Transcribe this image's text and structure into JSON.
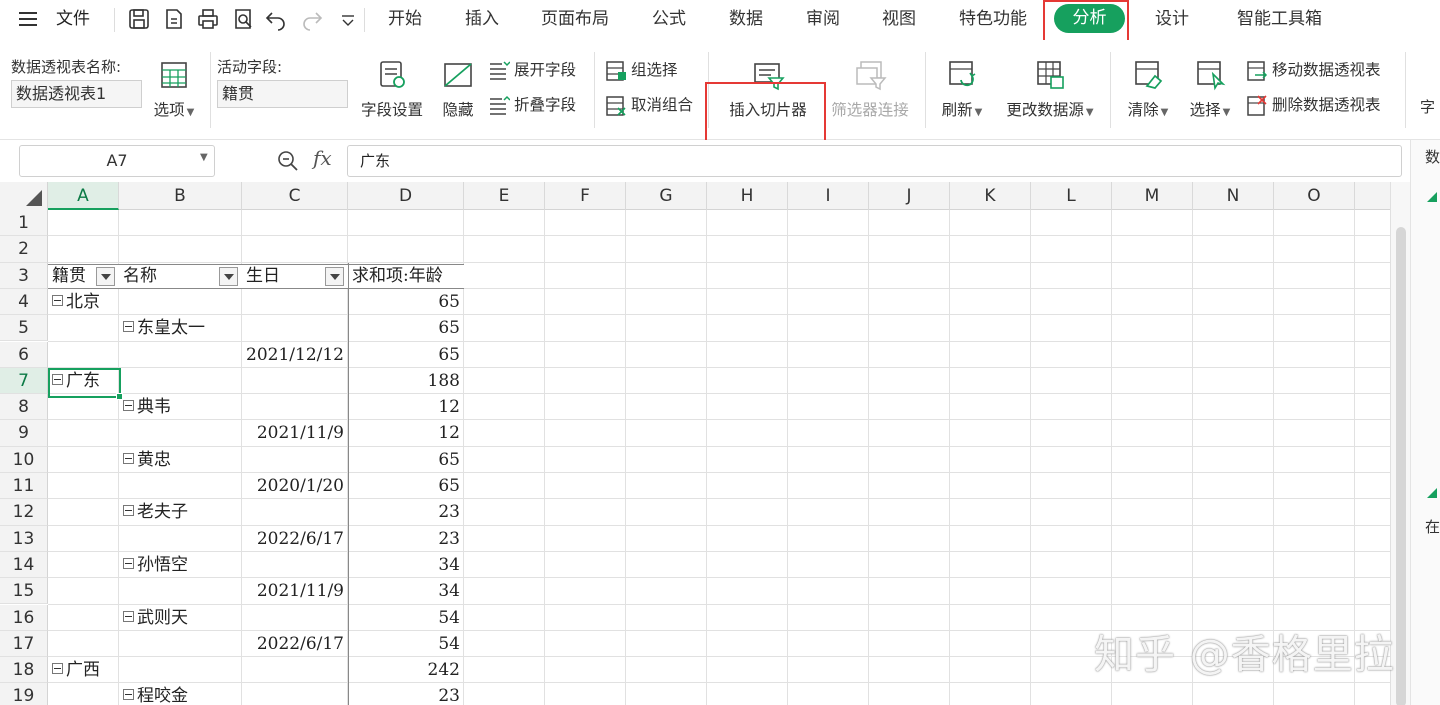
{
  "menubar": {
    "file_label": "文件",
    "tabs": [
      "开始",
      "插入",
      "页面布局",
      "公式",
      "数据",
      "审阅",
      "视图",
      "特色功能",
      "分析",
      "设计",
      "智能工具箱"
    ],
    "active_tab": "分析"
  },
  "ribbon": {
    "pivot_name_label": "数据透视表名称:",
    "pivot_name_value": "数据透视表1",
    "options_label": "选项",
    "active_field_label": "活动字段:",
    "active_field_value": "籍贯",
    "field_settings": "字段设置",
    "hide": "隐藏",
    "expand_field": "展开字段",
    "collapse_field": "折叠字段",
    "group_selection": "组选择",
    "ungroup": "取消组合",
    "insert_slicer": "插入切片器",
    "filter_connection": "筛选器连接",
    "refresh": "刷新",
    "change_source": "更改数据源",
    "clear": "清除",
    "select": "选择",
    "move_pivot": "移动数据透视表",
    "delete_pivot": "删除数据透视表",
    "cut_label": "字",
    "side_label_top": "数",
    "side_label_mid": "在"
  },
  "formula_bar": {
    "name_box": "A7",
    "fx": "fx",
    "formula": "广东"
  },
  "grid": {
    "columns": [
      "A",
      "B",
      "C",
      "D",
      "E",
      "F",
      "G",
      "H",
      "I",
      "J",
      "K",
      "L",
      "M",
      "N",
      "O"
    ],
    "rows": [
      "1",
      "2",
      "3",
      "4",
      "5",
      "6",
      "7",
      "8",
      "9",
      "10",
      "11",
      "12",
      "13",
      "14",
      "15",
      "16",
      "17",
      "18",
      "19"
    ],
    "selected_cell": "A7",
    "pivot_headers": [
      "籍贯",
      "名称",
      "生日",
      "求和项:年龄"
    ],
    "pivot_rows": [
      {
        "row": "4",
        "a": "北京",
        "b": "",
        "c": "",
        "d": "65",
        "collapse": "a"
      },
      {
        "row": "5",
        "a": "",
        "b": "东皇太一",
        "c": "",
        "d": "65",
        "collapse": "b"
      },
      {
        "row": "6",
        "a": "",
        "b": "",
        "c": "2021/12/12",
        "d": "65"
      },
      {
        "row": "7",
        "a": "广东",
        "b": "",
        "c": "",
        "d": "188",
        "collapse": "a"
      },
      {
        "row": "8",
        "a": "",
        "b": "典韦",
        "c": "",
        "d": "12",
        "collapse": "b"
      },
      {
        "row": "9",
        "a": "",
        "b": "",
        "c": "2021/11/9",
        "d": "12"
      },
      {
        "row": "10",
        "a": "",
        "b": "黄忠",
        "c": "",
        "d": "65",
        "collapse": "b"
      },
      {
        "row": "11",
        "a": "",
        "b": "",
        "c": "2020/1/20",
        "d": "65"
      },
      {
        "row": "12",
        "a": "",
        "b": "老夫子",
        "c": "",
        "d": "23",
        "collapse": "b"
      },
      {
        "row": "13",
        "a": "",
        "b": "",
        "c": "2022/6/17",
        "d": "23"
      },
      {
        "row": "14",
        "a": "",
        "b": "孙悟空",
        "c": "",
        "d": "34",
        "collapse": "b"
      },
      {
        "row": "15",
        "a": "",
        "b": "",
        "c": "2021/11/9",
        "d": "34"
      },
      {
        "row": "16",
        "a": "",
        "b": "武则天",
        "c": "",
        "d": "54",
        "collapse": "b"
      },
      {
        "row": "17",
        "a": "",
        "b": "",
        "c": "2022/6/17",
        "d": "54"
      },
      {
        "row": "18",
        "a": "广西",
        "b": "",
        "c": "",
        "d": "242",
        "collapse": "a"
      },
      {
        "row": "19",
        "a": "",
        "b": "程咬金",
        "c": "",
        "d": "23",
        "collapse": "b"
      }
    ]
  },
  "watermark": "知乎 @香格里拉",
  "colors": {
    "accent": "#16a05e",
    "highlight": "#e53935"
  }
}
